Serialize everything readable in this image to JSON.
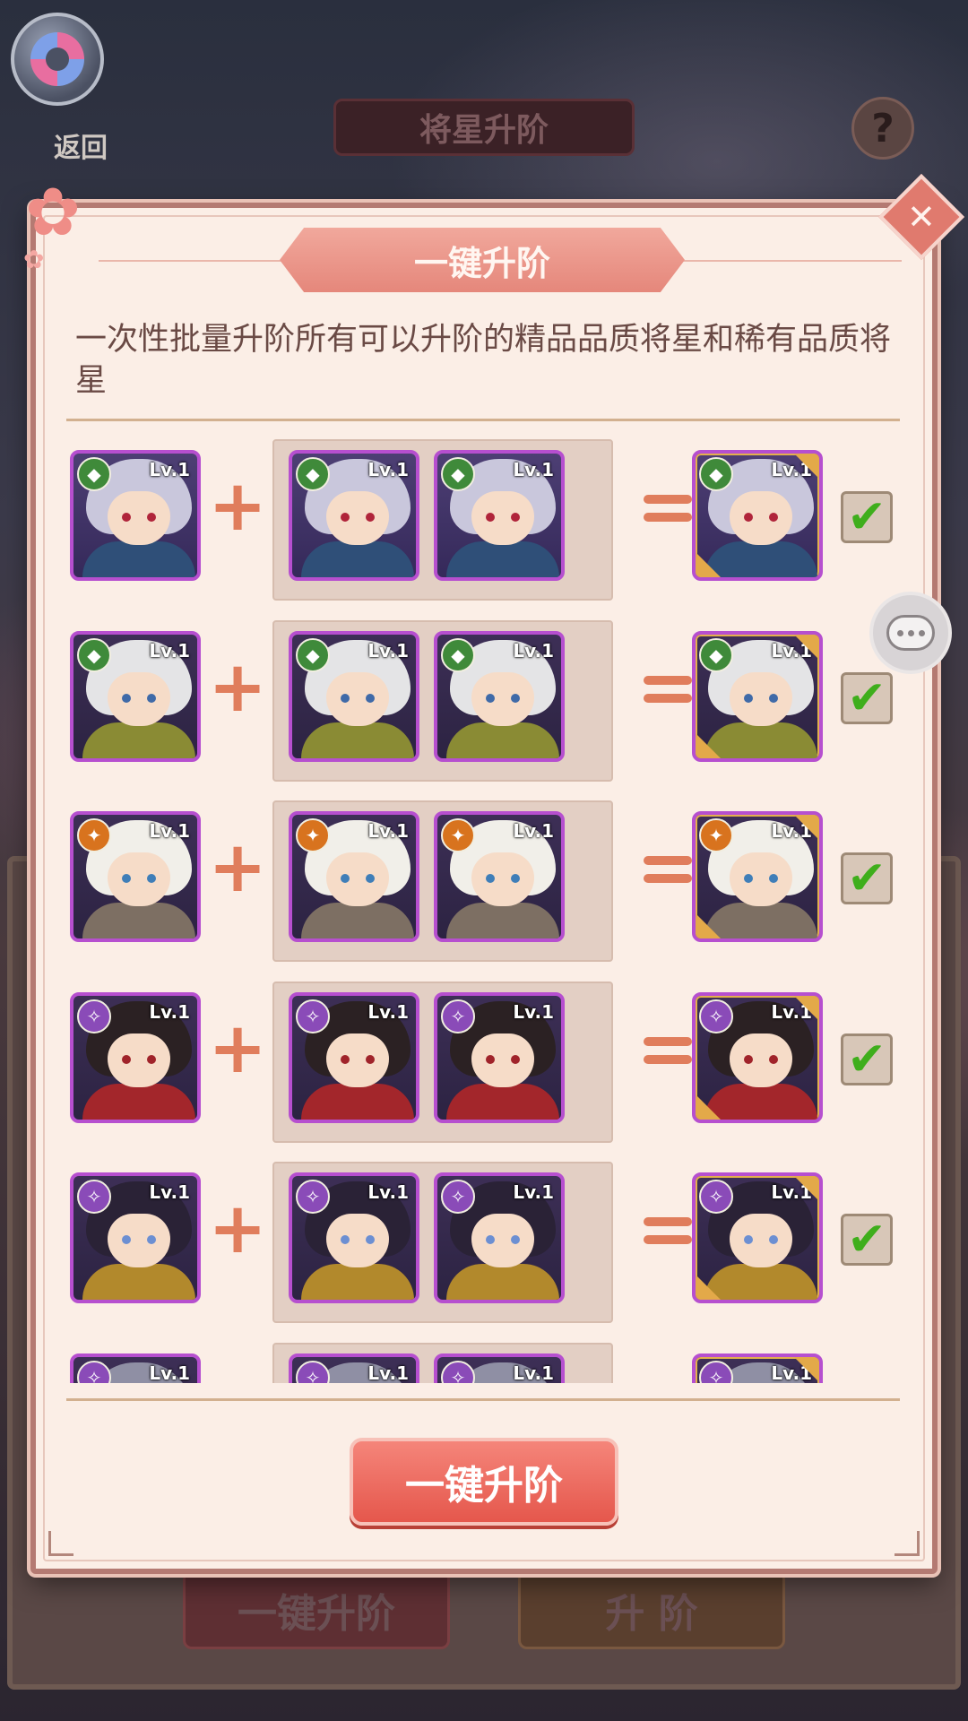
{
  "background": {
    "back_label": "返回",
    "page_title": "将星升阶",
    "help_symbol": "?",
    "buttons": {
      "batch_upgrade": "一键升阶",
      "upgrade": "升 阶"
    }
  },
  "dialog": {
    "title": "一键升阶",
    "description": "一次性批量升阶所有可以升阶的精品品质将星和稀有品质将星",
    "confirm_button": "一键升阶",
    "close_symbol": "✕",
    "colors": {
      "accent": "#e5574c",
      "panel": "#fbeee6",
      "card_border": "#b64fcf",
      "check": "#3fae1c"
    },
    "rows": [
      {
        "level": "Lv.1",
        "faction": "green",
        "hero": "silver-hair-blue-robe",
        "checked": true
      },
      {
        "level": "Lv.1",
        "faction": "green",
        "hero": "white-hair-green-armor",
        "checked": true
      },
      {
        "level": "Lv.1",
        "faction": "orange",
        "hero": "white-hair-headband",
        "checked": true
      },
      {
        "level": "Lv.1",
        "faction": "purple",
        "hero": "black-hair-red-robe",
        "checked": true
      },
      {
        "level": "Lv.1",
        "faction": "purple",
        "hero": "black-hair-gold-armor",
        "checked": true
      },
      {
        "level": "Lv.1",
        "faction": "purple",
        "hero": "grey-hair-partial",
        "checked": true
      }
    ]
  }
}
